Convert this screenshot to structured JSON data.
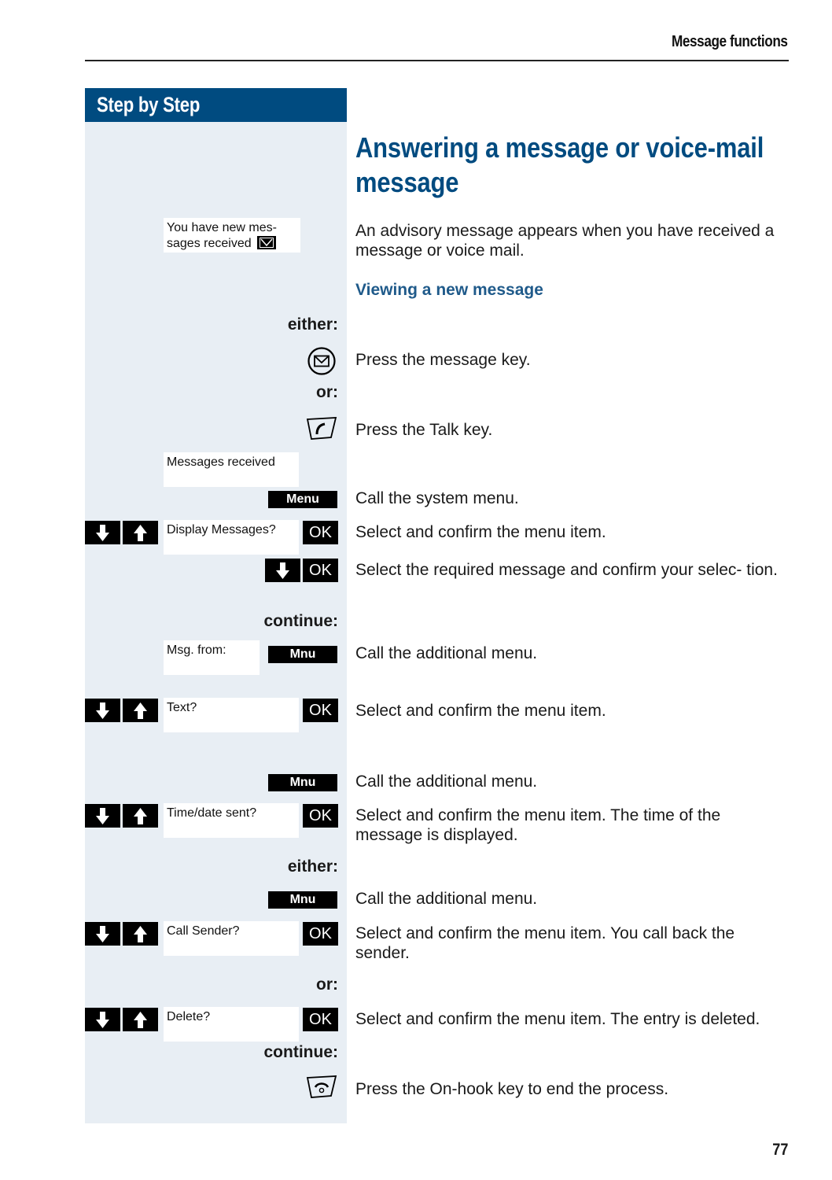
{
  "running_head": "Message functions",
  "sidebar": {
    "header": "Step by Step"
  },
  "title": "Answering a message or voice-mail message",
  "intro": "An advisory message appears when you have received a message or voice mail.",
  "subhead": "Viewing a new message",
  "labels": {
    "either_1": "either:",
    "or_1": "or:",
    "continue_1": "continue:",
    "either_2": "either:",
    "or_2": "or:",
    "continue_2": "continue:"
  },
  "displays": {
    "new_messages": "You have new mes- sages received",
    "messages_received": "Messages received",
    "display_messages": "Display Messages?",
    "msg_from": "Msg. from:",
    "text": "Text?",
    "time_date_sent": "Time/date sent?",
    "call_sender": "Call Sender?",
    "delete": "Delete?"
  },
  "softkeys": {
    "menu": "Menu",
    "mnu": "Mnu",
    "ok": "OK"
  },
  "icons": {
    "message_key": "envelope-circle-icon",
    "talk_key": "handset-talk-icon",
    "onhook_key": "handset-onhook-icon",
    "scroll_down": "arrow-down-icon",
    "scroll_up": "arrow-up-icon",
    "mailbox": "envelope-box-icon"
  },
  "steps": [
    "Press the message key.",
    "Press the Talk key.",
    "Call the system menu.",
    "Select and confirm the menu item.",
    "Select the required message and confirm your selec- tion.",
    "Call the additional menu.",
    "Select and confirm the menu item.",
    "Call the additional menu.",
    "Select and confirm the menu item. The time of the message is displayed.",
    "Call the additional menu.",
    "Select and confirm the menu item. You call back the sender.",
    "Select and confirm the menu item. The entry is deleted.",
    "Press the On-hook key to end the process."
  ],
  "page_number": "77",
  "colors": {
    "brand_blue": "#004b80",
    "sidebar_bg": "#e8eef4"
  }
}
